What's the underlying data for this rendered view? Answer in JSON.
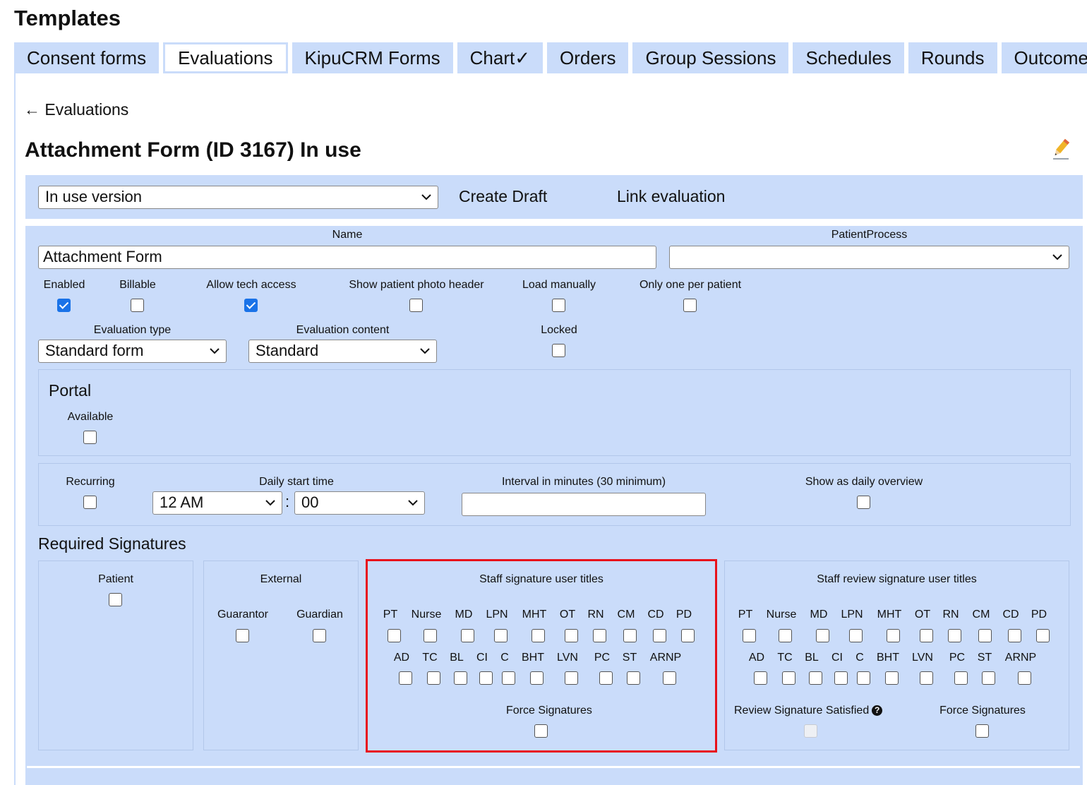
{
  "page": {
    "title": "Templates",
    "back_label": "← Evaluations",
    "heading": "Attachment Form (ID 3167) In use"
  },
  "tabs": [
    "Consent forms",
    "Evaluations",
    "KipuCRM Forms",
    "Chart✓",
    "Orders",
    "Group Sessions",
    "Schedules",
    "Rounds",
    "Outcomes"
  ],
  "active_tab": "Evaluations",
  "version_bar": {
    "version_value": "In use version",
    "create_draft": "Create Draft",
    "link_evaluation": "Link evaluation"
  },
  "form": {
    "name_label": "Name",
    "name_value": "Attachment Form",
    "patient_process_label": "PatientProcess",
    "patient_process_value": "",
    "flags": [
      {
        "label": "Enabled",
        "checked": true
      },
      {
        "label": "Billable",
        "checked": false
      },
      {
        "label": "Allow tech access",
        "checked": true
      },
      {
        "label": "Show patient photo header",
        "checked": false
      },
      {
        "label": "Load manually",
        "checked": false
      },
      {
        "label": "Only one per patient",
        "checked": false
      }
    ],
    "evaluation_type_label": "Evaluation type",
    "evaluation_type_value": "Standard form",
    "evaluation_content_label": "Evaluation content",
    "evaluation_content_value": "Standard",
    "locked_label": "Locked",
    "locked_checked": false
  },
  "portal": {
    "title": "Portal",
    "available_label": "Available",
    "available_checked": false
  },
  "recurring": {
    "recurring_label": "Recurring",
    "daily_start_label": "Daily start time",
    "hour_value": "12 AM",
    "separator": ":",
    "minute_value": "00",
    "interval_label": "Interval in minutes (30 minimum)",
    "interval_value": "",
    "daily_overview_label": "Show as daily overview"
  },
  "signatures": {
    "title": "Required Signatures",
    "patient_label": "Patient",
    "external_label": "External",
    "guarantor_label": "Guarantor",
    "guardian_label": "Guardian",
    "staff_title": "Staff signature user titles",
    "review_title": "Staff review signature user titles",
    "titles_row1": [
      "PT",
      "Nurse",
      "MD",
      "LPN",
      "MHT",
      "OT",
      "RN",
      "CM",
      "CD",
      "PD"
    ],
    "titles_row2": [
      "AD",
      "TC",
      "BL",
      "CI",
      "C",
      "BHT",
      "LVN",
      "PC",
      "ST",
      "ARNP"
    ],
    "force_label": "Force Signatures",
    "review_satisfied_label": "Review Signature Satisfied",
    "help_glyph": "?"
  },
  "colors": {
    "panel": "#cadcfa",
    "checkbox_checked": "#1a73e8",
    "highlight_border": "#e8121b"
  }
}
